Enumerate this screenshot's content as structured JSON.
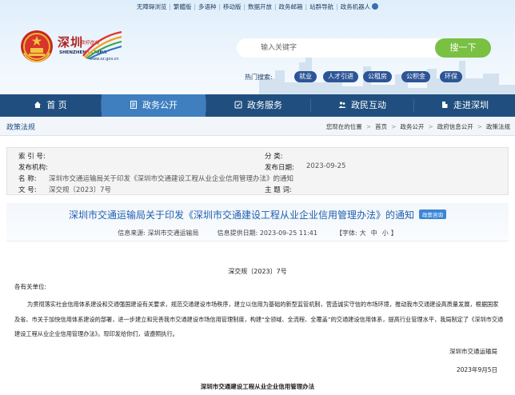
{
  "top_links": [
    "无障碍浏览",
    "繁體版",
    "多语种",
    "移动版",
    "数据开放",
    "政务邮箱",
    "站群导航",
    "政务机器人"
  ],
  "logo": {
    "title_cn": "深圳",
    "subtitle_cn": "政府在线",
    "en": "SHENZHEN · CHINA",
    "url": "www.sz.gov.cn"
  },
  "search": {
    "placeholder": "输入关键字",
    "button": "搜一下"
  },
  "hot_search": {
    "label": "热门搜索:",
    "tags": [
      "就业",
      "人才引进",
      "公租房",
      "公积金",
      "环保"
    ]
  },
  "nav": [
    {
      "label": "首 页",
      "icon": "home-icon"
    },
    {
      "label": "政务公开",
      "icon": "document-icon",
      "active": true
    },
    {
      "label": "政务服务",
      "icon": "service-icon"
    },
    {
      "label": "政民互动",
      "icon": "people-icon"
    },
    {
      "label": "走进深圳",
      "icon": "building-icon"
    }
  ],
  "section_title": "政策法规",
  "breadcrumb": {
    "prefix": "您现在的位置",
    "items": [
      "首页",
      "政务公开",
      "政府信息公开",
      "政策法规"
    ]
  },
  "meta": {
    "index_no": {
      "label": "索 引 号:",
      "value": ""
    },
    "category": {
      "label": "分    类:",
      "value": ""
    },
    "issuer": {
      "label": "发布机构:",
      "value": ""
    },
    "issue_date": {
      "label": "发布日期:",
      "value": "2023-09-25"
    },
    "name": {
      "label": "名    称:",
      "value": "深圳市交通运输局关于印发《深圳市交通建设工程从业企业信用管理办法》的通知"
    },
    "doc_no": {
      "label": "文    号:",
      "value": "深交规〔2023〕7号"
    },
    "keywords": {
      "label": "主 题 词:",
      "value": ""
    }
  },
  "article": {
    "title": "深圳市交通运输局关于印发《深圳市交通建设工程从业企业信用管理办法》的通知",
    "badge": "政策咨询",
    "source_label": "信息来源:",
    "source": "深圳市交通运输局",
    "date_label": "信息提供日期:",
    "date": "2023-09-25 11:41",
    "font_label": "【字体:",
    "font_sizes": [
      "大",
      "中",
      "小"
    ],
    "font_close": "】",
    "doc_no": "深交规〔2023〕7号",
    "greeting": "各有关单位:",
    "paragraph": "为贯彻落实社会信用体系建设和交通强国建设有关要求，规范交通建设市场秩序，建立以信用为基础的新型监管机制，营造诚实守信的市场环境，推动我市交通建设高质量发展，根据国家及省、市关于加快信用体系建设的部署，进一步建立和完善我市交通建设市场信用管理制度，构建“全领域、全流程、全覆盖”的交通建设信用体系，提高行业管理水平，我局制定了《深圳市交通建设工程从业企业信用管理办法》。现印发给你们，请遵照执行。",
    "signature_org": "深圳市交通运输局",
    "signature_date": "2023年9月5日",
    "appendix_title": "深圳市交通建设工程从业企业信用管理办法"
  }
}
